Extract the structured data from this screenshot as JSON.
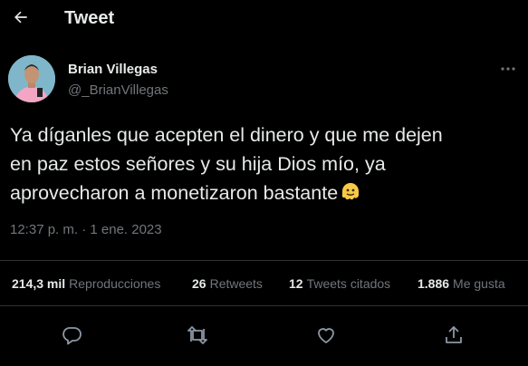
{
  "header": {
    "title": "Tweet",
    "back_icon": "arrow-left-icon"
  },
  "author": {
    "name": "Brian Villegas",
    "handle": "@_BrianVillegas",
    "avatar_icon": "profile-avatar"
  },
  "tweet": {
    "lines": [
      "Ya díganles que acepten el dinero y que me dejen",
      "en paz estos señores y su hija Dios mío, ya",
      "aprovecharon a monetizaron bastante"
    ],
    "emoji": "melting-face-emoji",
    "timestamp": "12:37 p. m. · 1 ene. 2023"
  },
  "stats": {
    "views": {
      "value": "214,3 mil",
      "label": "Reproducciones"
    },
    "retweets": {
      "value": "26",
      "label": "Retweets"
    },
    "quotes": {
      "value": "12",
      "label": "Tweets citados"
    },
    "likes": {
      "value": "1.886",
      "label": "Me gusta"
    }
  },
  "actions": [
    "reply-icon",
    "retweet-icon",
    "like-icon",
    "share-icon"
  ],
  "colors": {
    "background": "#000000",
    "text": "#e7e9ea",
    "secondary": "#71767b",
    "divider": "#2f3336"
  }
}
